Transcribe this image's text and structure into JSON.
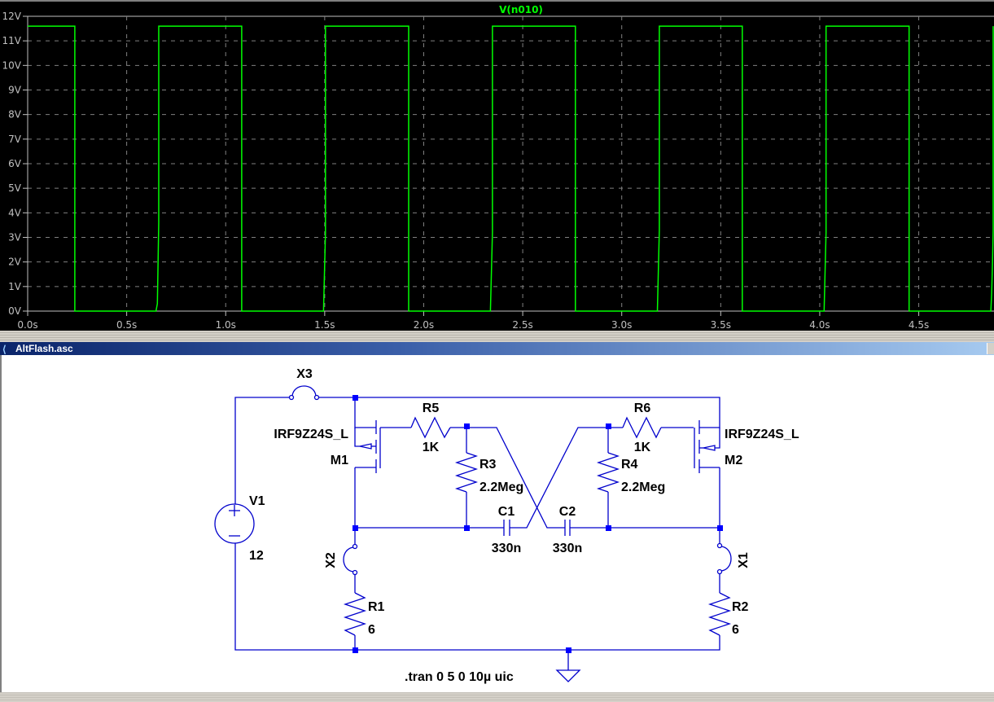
{
  "plot": {
    "trace_color": "#00ff00",
    "grid_color": "#808080",
    "axis_text_color": "#c0c0c0"
  },
  "chart_data": {
    "type": "line",
    "title": "V(n010)",
    "xlabel": "",
    "ylabel": "",
    "xlim": [
      0,
      4.88
    ],
    "ylim": [
      0,
      12
    ],
    "grid": true,
    "x_ticks": [
      0,
      0.5,
      1.0,
      1.5,
      2.0,
      2.5,
      3.0,
      3.5,
      4.0,
      4.5
    ],
    "x_tick_labels": [
      "0.0s",
      "0.5s",
      "1.0s",
      "1.5s",
      "2.0s",
      "2.5s",
      "3.0s",
      "3.5s",
      "4.0s",
      "4.5s"
    ],
    "y_ticks": [
      0,
      1,
      2,
      3,
      4,
      5,
      6,
      7,
      8,
      9,
      10,
      11,
      12
    ],
    "y_tick_labels": [
      "0V",
      "1V",
      "2V",
      "3V",
      "4V",
      "5V",
      "6V",
      "7V",
      "8V",
      "9V",
      "10V",
      "11V",
      "12V"
    ],
    "series": [
      {
        "name": "V(n010)",
        "color": "#00ff00",
        "points": [
          [
            0,
            11.6
          ],
          [
            0.238,
            11.6
          ],
          [
            0.238,
            0
          ],
          [
            0.648,
            0
          ],
          [
            0.655,
            0.3
          ],
          [
            0.662,
            3.6
          ],
          [
            0.662,
            11.6
          ],
          [
            1.081,
            11.6
          ],
          [
            1.081,
            0
          ],
          [
            1.494,
            0
          ],
          [
            1.504,
            3.2
          ],
          [
            1.504,
            11.6
          ],
          [
            1.924,
            11.6
          ],
          [
            1.924,
            0
          ],
          [
            2.337,
            0
          ],
          [
            2.347,
            3.2
          ],
          [
            2.347,
            11.6
          ],
          [
            2.766,
            11.6
          ],
          [
            2.766,
            0
          ],
          [
            3.18,
            0
          ],
          [
            3.19,
            3.3
          ],
          [
            3.19,
            11.6
          ],
          [
            3.609,
            11.6
          ],
          [
            3.609,
            0
          ],
          [
            4.022,
            0
          ],
          [
            4.032,
            3.2
          ],
          [
            4.032,
            11.6
          ],
          [
            4.451,
            11.6
          ],
          [
            4.451,
            0
          ],
          [
            4.864,
            0
          ],
          [
            4.868,
            0.7
          ],
          [
            4.872,
            1.9
          ],
          [
            4.876,
            3.3
          ],
          [
            4.876,
            11.6
          ]
        ]
      }
    ]
  },
  "window": {
    "title": "AltFlash.asc"
  },
  "schematic": {
    "wire_color": "#0000cc",
    "components": {
      "X3": "X3",
      "X2": "X2",
      "X1": "X1",
      "V1": "V1",
      "V1_value": "12",
      "M1": "M1",
      "M1_model": "IRF9Z24S_L",
      "M2": "M2",
      "M2_model": "IRF9Z24S_L",
      "R5": "R5",
      "R5_value": "1K",
      "R6": "R6",
      "R6_value": "1K",
      "R3": "R3",
      "R3_value": "2.2Meg",
      "R4": "R4",
      "R4_value": "2.2Meg",
      "C1": "C1",
      "C1_value": "330n",
      "C2": "C2",
      "C2_value": "330n",
      "R1": "R1",
      "R1_value": "6",
      "R2": "R2",
      "R2_value": "6"
    },
    "directive": ".tran 0 5 0 10µ uic"
  }
}
